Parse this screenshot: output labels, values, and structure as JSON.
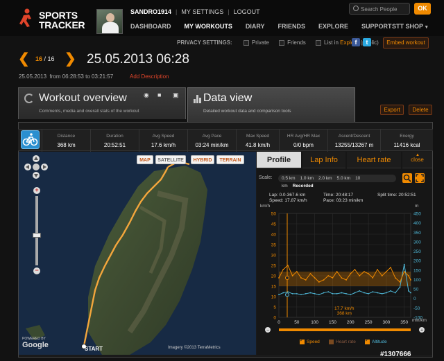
{
  "brand": {
    "line1": "SPORTS",
    "line2": "TRACKER"
  },
  "user": {
    "name": "SANDRO1914",
    "settings": "MY SETTINGS",
    "logout": "LOGOUT"
  },
  "search": {
    "placeholder": "Search People",
    "ok": "OK"
  },
  "nav": {
    "items": [
      "DASHBOARD",
      "MY WORKOUTS",
      "DIARY",
      "FRIENDS",
      "EXPLORE",
      "SUPPORT"
    ],
    "shop": "STT SHOP"
  },
  "privacy": {
    "label": "PRIVACY SETTINGS:",
    "private": "Private",
    "friends": "Friends",
    "list_in": "List in",
    "explore": "Explore",
    "public": "(public)",
    "embed": "Embed workout",
    "fb": "f",
    "tw": "t"
  },
  "workout": {
    "prev": "❮",
    "next": "❯",
    "current": "16",
    "total": "/ 16",
    "title": "25.05.2013 06:28",
    "date": "25.05.2013",
    "from_label": "from",
    "start": "06:28:53",
    "to_label": "to",
    "end": "03:21:57",
    "add_description": "Add Description"
  },
  "tabs": {
    "overview_title": "Workout overview",
    "overview_sub": "Comments, media and overall stats of the workout",
    "data_title": "Data view",
    "data_sub": "Detailed workout data and comparison tools",
    "export": "Export",
    "delete": "Delete"
  },
  "stats": [
    {
      "label": "Distance",
      "value": "368 km"
    },
    {
      "label": "Duration",
      "value": "20:52:51"
    },
    {
      "label": "Avg Speed",
      "value": "17.6 km/h"
    },
    {
      "label": "Avg Pace",
      "value": "03:24 min/km"
    },
    {
      "label": "Max Speed",
      "value": "41.8 km/h"
    },
    {
      "label": "HR Avg/HR Max",
      "value": "0/0 bpm"
    },
    {
      "label": "Ascent/Descent",
      "value": "13255/13267 m"
    },
    {
      "label": "Energy",
      "value": "11416 kcal"
    }
  ],
  "map": {
    "types": [
      "MAP",
      "SATELLITE",
      "HYBRID",
      "TERRAIN"
    ],
    "start": "START",
    "imagery": "Imagery ©2013 TerraMetrics",
    "powered": "POWERED BY",
    "google": "Google"
  },
  "chart_tabs": {
    "profile": "Profile",
    "lap_info": "Lap Info",
    "heart_rate": "Heart rate",
    "close": "close"
  },
  "scale": {
    "label": "Scale:",
    "options": [
      "0.5 km",
      "1.0 km",
      "2.0 km",
      "5.0 km",
      "10 km",
      "Recorded"
    ]
  },
  "readout": {
    "lap_label": "Lap:",
    "lap": "0.0-367.6 km",
    "speed_label": "Speed:",
    "speed": "17.87 km/h",
    "time_label": "Time:",
    "time": "20:48:17",
    "pace_label": "Pace:",
    "pace": "03:23 min/km",
    "split_label": "Split time:",
    "split": "20:52:51",
    "cursor_speed": "17.7 km/h",
    "cursor_dist": "368 km"
  },
  "legend": {
    "speed": "Speed",
    "heart": "Heart rate",
    "altitude": "Altitude"
  },
  "footer": {
    "id": "#1307666"
  },
  "colors": {
    "accent": "#f08a00",
    "altitude": "#4fb8d8",
    "danger": "#e0442a"
  },
  "chart_data": {
    "type": "line",
    "xlabel": "min/km",
    "x_ticks": [
      0,
      50,
      100,
      150,
      200,
      250,
      300,
      350
    ],
    "xlim": [
      0,
      368
    ],
    "y_left_label": "km/h",
    "y_left_ticks": [
      0,
      5,
      10,
      15,
      20,
      25,
      30,
      35,
      40,
      45,
      50
    ],
    "y_left_lim": [
      0,
      50
    ],
    "y_right_label": "m",
    "y_right_ticks": [
      -100,
      -50,
      0,
      50,
      100,
      150,
      200,
      250,
      300,
      350,
      400,
      450
    ],
    "y_right_lim": [
      -100,
      450
    ],
    "series": [
      {
        "name": "Speed",
        "axis": "left",
        "x": [
          0,
          12,
          25,
          38,
          50,
          62,
          75,
          88,
          100,
          112,
          125,
          138,
          150,
          162,
          175,
          188,
          200,
          212,
          225,
          238,
          250,
          262,
          275,
          288,
          300,
          312,
          325,
          338,
          350,
          362,
          368
        ],
        "values": [
          19,
          23,
          25,
          20,
          22,
          19,
          18,
          21,
          19,
          17,
          18,
          20,
          19,
          22,
          19,
          18,
          21,
          23,
          20,
          22,
          21,
          19,
          23,
          20,
          22,
          24,
          19,
          17,
          22,
          20,
          18
        ]
      },
      {
        "name": "Altitude",
        "axis": "right",
        "x": [
          0,
          12,
          25,
          38,
          50,
          62,
          75,
          88,
          100,
          112,
          125,
          138,
          150,
          162,
          175,
          188,
          200,
          212,
          225,
          238,
          250,
          262,
          275,
          288,
          300,
          312,
          325,
          338,
          350,
          362,
          368
        ],
        "values": [
          20,
          30,
          35,
          25,
          25,
          20,
          25,
          30,
          25,
          20,
          30,
          35,
          25,
          25,
          30,
          25,
          20,
          30,
          40,
          30,
          25,
          35,
          30,
          25,
          30,
          40,
          30,
          60,
          180,
          40,
          30
        ]
      }
    ]
  }
}
